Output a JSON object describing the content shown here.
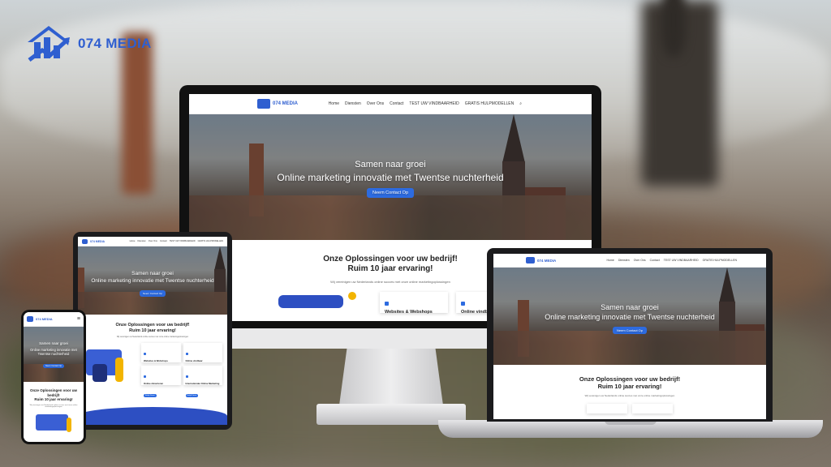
{
  "brand": {
    "name": "074 MEDIA",
    "color": "#2f5fd0",
    "logo_icon": "building-chart-icon"
  },
  "site": {
    "logo_text": "074 MEDIA",
    "nav": [
      "Home",
      "Diensten",
      "Over Ons",
      "Contact",
      "TEST UW VINDBAARHEID",
      "GRATIS HULPMODELLEN"
    ],
    "nav_dropdown_icon": "chevron-down-icon",
    "search_icon": "search-icon",
    "hero_line1": "Samen naar groei",
    "hero_line2": "Online marketing innovatie met Twentse nuchterheid",
    "hero_button": "Neem Contact Op",
    "section_title_1": "Onze Oplossingen voor uw bedrijf!",
    "section_title_2": "Ruim 10 jaar ervaring!",
    "section_text": "Wij vereinigen uw Nederlands online succes met onze online marketingoplossingen",
    "cards": [
      {
        "title": "Websites & Webshops",
        "button": "Bekijk Dienst"
      },
      {
        "title": "Online vindbaar",
        "button": "Bekijk Dienst"
      },
      {
        "title": "Online Adverteren",
        "button": "Bekijk Dienst"
      },
      {
        "title": "Internationale Online Marketing",
        "button": "Bekijk Dienst"
      }
    ],
    "accent": "#2d6be0"
  }
}
